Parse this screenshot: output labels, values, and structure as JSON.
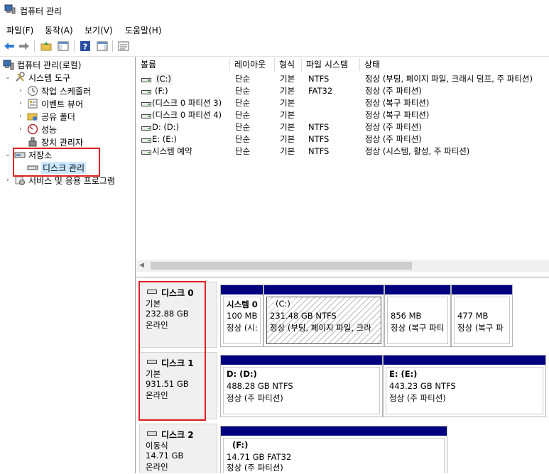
{
  "window": {
    "title": "컴퓨터 관리"
  },
  "menu": [
    "파일(F)",
    "동작(A)",
    "보기(V)",
    "도움말(H)"
  ],
  "tree": {
    "root": "컴퓨터 관리(로컬)",
    "system_tools": "시스템 도구",
    "task_scheduler": "작업 스케줄러",
    "event_viewer": "이벤트 뷰어",
    "shared_folders": "공유 폴더",
    "performance": "성능",
    "device_manager": "장치 관리자",
    "storage": "저장소",
    "disk_management": "디스크 관리",
    "services_apps": "서비스 및 응용 프로그램"
  },
  "list": {
    "columns": [
      "볼륨",
      "레이아웃",
      "형식",
      "파일 시스템",
      "상태"
    ],
    "rows": [
      {
        "volume": "(C:)",
        "layout": "단순",
        "type": "기본",
        "fs": "NTFS",
        "status": "정상 (부팅, 페이지 파일, 크래시 덤프, 주 파티션)"
      },
      {
        "volume": "(F:)",
        "layout": "단순",
        "type": "기본",
        "fs": "FAT32",
        "status": "정상 (주 파티션)"
      },
      {
        "volume": "(디스크 0 파티션 3)",
        "layout": "단순",
        "type": "기본",
        "fs": "",
        "status": "정상 (복구 파티션)"
      },
      {
        "volume": "(디스크 0 파티션 4)",
        "layout": "단순",
        "type": "기본",
        "fs": "",
        "status": "정상 (복구 파티션)"
      },
      {
        "volume": "D: (D:)",
        "layout": "단순",
        "type": "기본",
        "fs": "NTFS",
        "status": "정상 (주 파티션)"
      },
      {
        "volume": "E: (E:)",
        "layout": "단순",
        "type": "기본",
        "fs": "NTFS",
        "status": "정상 (주 파티션)"
      },
      {
        "volume": "시스템 예약",
        "layout": "단순",
        "type": "기본",
        "fs": "NTFS",
        "status": "정상 (시스템, 활성, 주 파티션)"
      }
    ]
  },
  "disks": [
    {
      "name": "디스크 0",
      "kind": "기본",
      "size": "232.88 GB",
      "state": "온라인",
      "partitions": [
        {
          "title": "시스템 0",
          "size": "100 MB",
          "status": "정상 (시:"
        },
        {
          "title": "(C:)",
          "size": "231.48 GB NTFS",
          "status": "정상 (부팅, 페이지 파일, 크라"
        },
        {
          "title": "",
          "size": "856 MB",
          "status": "정상 (복구 파티"
        },
        {
          "title": "",
          "size": "477 MB",
          "status": "정상 (복구 파"
        }
      ]
    },
    {
      "name": "디스크 1",
      "kind": "기본",
      "size": "931.51 GB",
      "state": "온라인",
      "partitions": [
        {
          "title": "D:  (D:)",
          "size": "488.28 GB NTFS",
          "status": "정상 (주 파티션)"
        },
        {
          "title": "E:  (E:)",
          "size": "443.23 GB NTFS",
          "status": "정상 (주 파티션)"
        }
      ]
    },
    {
      "name": "디스크 2",
      "kind": "이동식",
      "size": "14.71 GB",
      "state": "온라인",
      "partitions": [
        {
          "title": "(F:)",
          "size": "14.71 GB FAT32",
          "status": "정상 (주 파티션)"
        }
      ]
    }
  ],
  "colors": {
    "partition_bar": "#00007e",
    "highlight": "#e02020",
    "selection": "#cce8ff"
  }
}
